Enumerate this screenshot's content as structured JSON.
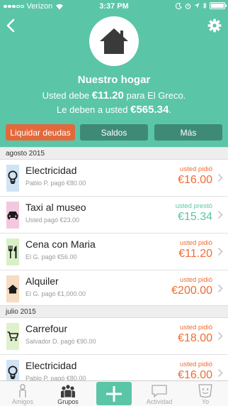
{
  "status_bar": {
    "carrier": "Verizon",
    "time": "3:37 PM"
  },
  "group": {
    "name": "Nuestro hogar",
    "you_owe_prefix": "Usted debe",
    "you_owe_amount": "€11.20",
    "you_owe_suffix": "para El Greco.",
    "owed_prefix": "Le deben a usted",
    "owed_amount": "€565.34",
    "owed_suffix": "."
  },
  "actions": {
    "settle": "Liquidar deudas",
    "balances": "Saldos",
    "more": "Más"
  },
  "sections": [
    {
      "title": "agosto 2015",
      "items": [
        {
          "icon": "lightbulb-icon",
          "icon_bg": "#cfe3f5",
          "title": "Electricidad",
          "subtitle": "Pablo P. pagó €80.00",
          "label": "usted pidió",
          "amount": "€16.00",
          "kind": "borrowed"
        },
        {
          "icon": "car-icon",
          "icon_bg": "#f3c8de",
          "title": "Taxi al museo",
          "subtitle": "Usted pagó €23.00",
          "label": "usted prestó",
          "amount": "€15.34",
          "kind": "lent"
        },
        {
          "icon": "fork-knife-icon",
          "icon_bg": "#d8f0c6",
          "title": "Cena con Maria",
          "subtitle": "El G. pagó €56.00",
          "label": "usted pidió",
          "amount": "€11.20",
          "kind": "borrowed"
        },
        {
          "icon": "home-icon",
          "icon_bg": "#f5dcc2",
          "title": "Alquiler",
          "subtitle": "El G. pagó €1,000.00",
          "label": "usted pidió",
          "amount": "€200.00",
          "kind": "borrowed"
        }
      ]
    },
    {
      "title": "julio 2015",
      "items": [
        {
          "icon": "shopping-cart-icon",
          "icon_bg": "#dff0cc",
          "title": "Carrefour",
          "subtitle": "Salvador D. pagó €90.00",
          "label": "usted pidió",
          "amount": "€18.00",
          "kind": "borrowed"
        },
        {
          "icon": "lightbulb-icon",
          "icon_bg": "#cfe3f5",
          "title": "Electricidad",
          "subtitle": "Pablo P. pagó €80.00",
          "label": "usted pidió",
          "amount": "€16.00",
          "kind": "borrowed"
        }
      ]
    }
  ],
  "tabs": {
    "friends": "Amigos",
    "groups": "Grupos",
    "activity": "Actividad",
    "you": "Yo"
  },
  "colors": {
    "brand": "#5bc5a7",
    "borrowed": "#ef6c32",
    "lent": "#5bc5a7",
    "button_dark": "#3f8a76",
    "button_settle": "#e2693c"
  }
}
